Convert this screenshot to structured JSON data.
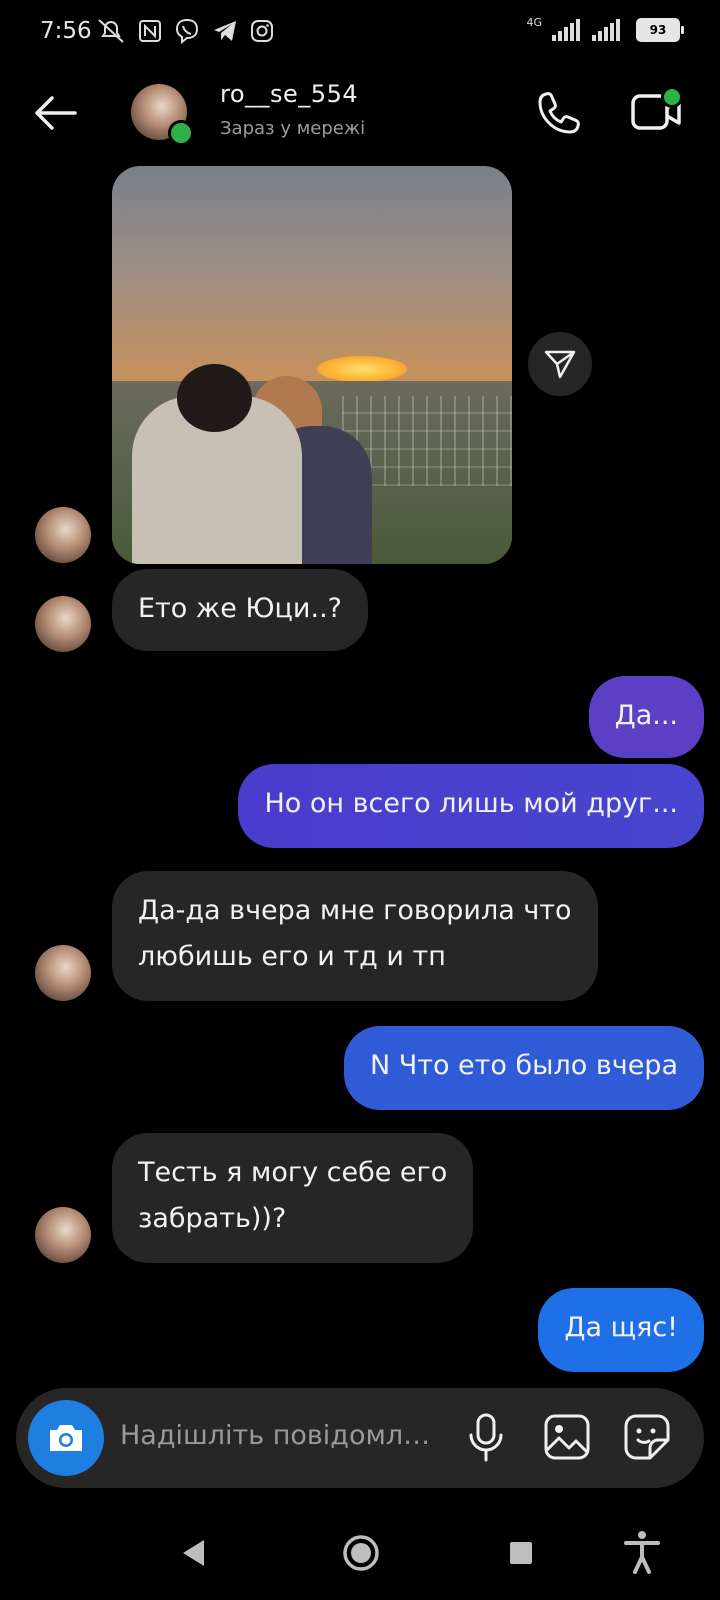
{
  "status_bar": {
    "time": "7:56",
    "network": "4G",
    "battery": "93"
  },
  "header": {
    "username": "ro__se_554",
    "status": "Зараз у мережі"
  },
  "messages": [
    {
      "from": "them",
      "text": "Ето же Юци..?"
    },
    {
      "from": "me",
      "text": "Да..."
    },
    {
      "from": "me",
      "text": "Но он всего лишь мой друг..."
    },
    {
      "from": "them",
      "line1": "Да-да вчера мне говорила что",
      "line2": "любишь его и тд и тп"
    },
    {
      "from": "me",
      "text": "N Что ето было вчера"
    },
    {
      "from": "them",
      "line1": "Тесть я могу себе его",
      "line2": "забрать))?"
    },
    {
      "from": "me",
      "text": "Да щяс!"
    }
  ],
  "composer": {
    "placeholder": "Надішліть повідомл…"
  },
  "colors": {
    "incoming_bubble": "#262626",
    "outgoing_purple": "#5b3fc4",
    "outgoing_blue": "#2a5fd8",
    "camera_button": "#1e7fe0",
    "online": "#2bb34a"
  },
  "icons": [
    "back-arrow-icon",
    "phone-icon",
    "video-call-icon",
    "send-icon",
    "camera-icon",
    "mic-icon",
    "gallery-icon",
    "sticker-icon",
    "nav-back-icon",
    "nav-home-icon",
    "nav-recents-icon",
    "accessibility-icon"
  ]
}
